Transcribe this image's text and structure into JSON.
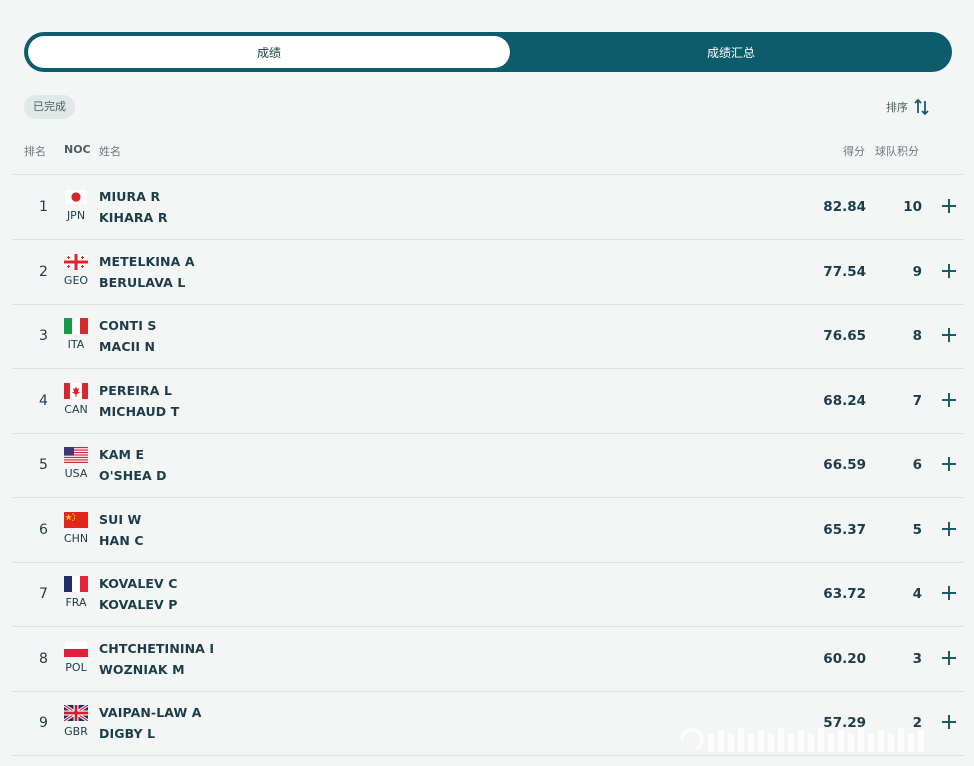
{
  "tabs": {
    "results": "成绩",
    "summary": "成绩汇总"
  },
  "status_badge": "已完成",
  "sort_label": "排序",
  "headers": {
    "rank": "排名",
    "noc": "NOC",
    "name": "姓名",
    "score": "得分",
    "team_points": "球队积分"
  },
  "rows": [
    {
      "rank": "1",
      "noc": "JPN",
      "flag": "jpn-flag",
      "name1": "MIURA R",
      "name2": "KIHARA R",
      "score": "82.84",
      "points": "10"
    },
    {
      "rank": "2",
      "noc": "GEO",
      "flag": "geo-flag",
      "name1": "METELKINA A",
      "name2": "BERULAVA L",
      "score": "77.54",
      "points": "9"
    },
    {
      "rank": "3",
      "noc": "ITA",
      "flag": "ita-flag",
      "name1": "CONTI S",
      "name2": "MACII N",
      "score": "76.65",
      "points": "8"
    },
    {
      "rank": "4",
      "noc": "CAN",
      "flag": "can-flag",
      "name1": "PEREIRA L",
      "name2": "MICHAUD T",
      "score": "68.24",
      "points": "7"
    },
    {
      "rank": "5",
      "noc": "USA",
      "flag": "usa-flag",
      "name1": "KAM E",
      "name2": "O'SHEA D",
      "score": "66.59",
      "points": "6"
    },
    {
      "rank": "6",
      "noc": "CHN",
      "flag": "chn-flag",
      "name1": "SUI W",
      "name2": "HAN C",
      "score": "65.37",
      "points": "5"
    },
    {
      "rank": "7",
      "noc": "FRA",
      "flag": "fra-flag",
      "name1": "KOVALEV C",
      "name2": "KOVALEV P",
      "score": "63.72",
      "points": "4"
    },
    {
      "rank": "8",
      "noc": "POL",
      "flag": "pol-flag",
      "name1": "CHTCHETININA I",
      "name2": "WOZNIAK M",
      "score": "60.20",
      "points": "3"
    },
    {
      "rank": "9",
      "noc": "GBR",
      "flag": "gbr-flag",
      "name1": "VAIPAN-LAW A",
      "name2": "DIGBY L",
      "score": "57.29",
      "points": "2"
    }
  ],
  "colors": {
    "accent": "#0d5c6c",
    "text": "#1c3d4a",
    "background": "#f4f5f5"
  }
}
